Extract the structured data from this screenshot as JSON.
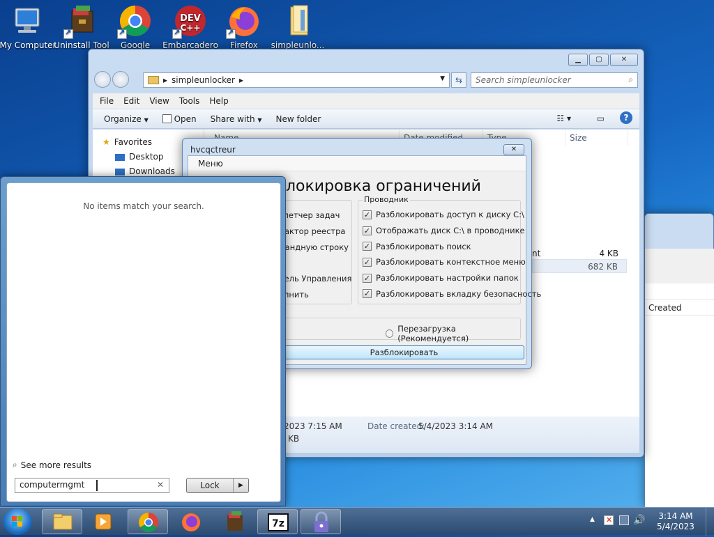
{
  "desktop": {
    "icons": [
      {
        "label": "My Computer"
      },
      {
        "label": "Uninstall Tool"
      },
      {
        "label": "Google"
      },
      {
        "label": "Embarcadero"
      },
      {
        "label": "Firefox"
      },
      {
        "label": "simpleunlo..."
      }
    ]
  },
  "explorer": {
    "path": "simpleunlocker",
    "search_placeholder": "Search simpleunlocker",
    "menu": [
      "File",
      "Edit",
      "View",
      "Tools",
      "Help"
    ],
    "toolbar": {
      "organize": "Organize",
      "open": "Open",
      "share": "Share with",
      "newfolder": "New folder"
    },
    "columns": {
      "name": "Name",
      "date": "Date modified",
      "type": "Type",
      "size": "Size"
    },
    "nav": {
      "favorites": "Favorites",
      "desktop": "Desktop",
      "downloads": "Downloads"
    },
    "rows": [
      {
        "type": "nt",
        "size": "4 KB"
      },
      {
        "type": "",
        "size": "682 KB"
      }
    ],
    "details": {
      "modified": "/2023 7:15 AM",
      "created_label": "Date created:",
      "created": "5/4/2023 3:14 AM",
      "size": "KB"
    }
  },
  "background_window": {
    "column": "Created"
  },
  "dialog": {
    "title": "hvcqctreur",
    "menu": "Меню",
    "heading": "локировка ограничений",
    "left_items": [
      "спетчер задач",
      "дактор реестра",
      "мандную строку",
      "С",
      "нель Управления",
      "олнить"
    ],
    "right_group_title": "Проводник",
    "right_items": [
      "Разблокировать доступ к диску C:\\",
      "Отображать диск C:\\ в проводнике",
      "Разблокировать поиск",
      "Разблокировать контекстное меню",
      "Разблокировать настройки папок",
      "Разблокировать вкладку безопасность"
    ],
    "reboot": "Перезагрузка (Рекомендуется)",
    "unlock_button": "Разблокировать"
  },
  "start_menu": {
    "no_items": "No items match your search.",
    "see_more": "See more results",
    "search_value": "computermgmt",
    "lock_label": "Lock"
  },
  "taskbar": {
    "time": "3:14 AM",
    "date": "5/4/2023"
  }
}
